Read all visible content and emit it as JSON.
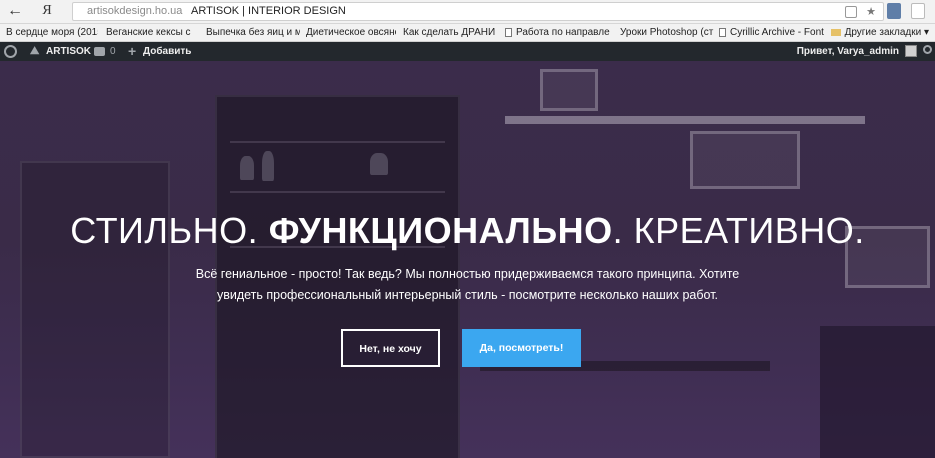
{
  "browser": {
    "yandex_button": "Я",
    "url_host": "artisokdesign.ho.ua",
    "page_title": "ARTISOK | INTERIOR DESIGN"
  },
  "bookmarks": [
    "В сердце моря (2015",
    "Веганские кексы с я",
    "Выпечка без яиц и м",
    "Диетическое овсяно",
    "Как сделать ДРАНИ",
    "Работа по направле",
    "Уроки Photoshop (ст",
    "Cyrillic Archive - Font"
  ],
  "other_bookmarks": "Другие закладки",
  "adminbar": {
    "site_name": "ARTISOK",
    "comments_count": "0",
    "new_label": "Добавить",
    "howdy": "Привет, Varya_admin"
  },
  "hero": {
    "heading_part1": "СТИЛЬНО. ",
    "heading_bold": "ФУНКЦИОНАЛЬНО",
    "heading_part2": ". КРЕАТИВНО.",
    "text_line1": "Всё гениальное - просто! Так ведь? Мы полностью придерживаемся такого принципа. Хотите",
    "text_line2": "увидеть профессиональный интерьерный стиль - посмотрите несколько наших работ.",
    "button_no": "Нет, не хочу",
    "button_yes": "Да, посмотреть!"
  },
  "colors": {
    "accent": "#3ba7f0",
    "adminbar_bg": "#23282d",
    "hero_overlay": "#3b2c4b"
  }
}
